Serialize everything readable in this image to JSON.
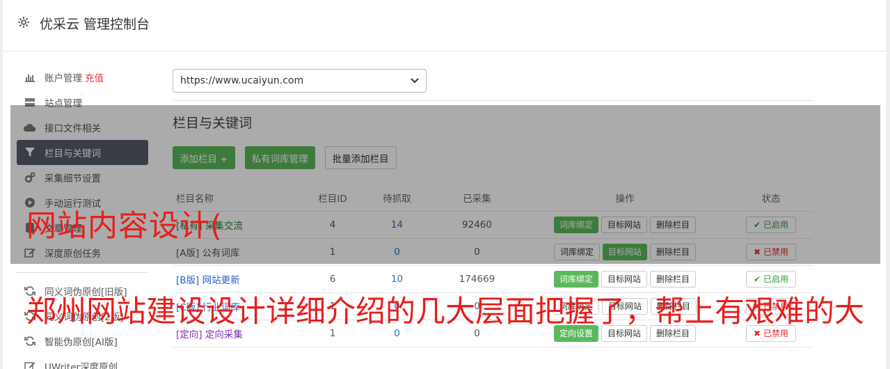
{
  "header": {
    "title": "优采云 管理控制台"
  },
  "sidebar": {
    "items": [
      {
        "label": "账户管理",
        "extra": "充值"
      },
      {
        "label": "站点管理"
      },
      {
        "label": "接口文件相关"
      },
      {
        "label": "栏目与关键词"
      },
      {
        "label": "采集细节设置"
      },
      {
        "label": "手动运行测试"
      },
      {
        "label": "文章管理"
      },
      {
        "label": "深度原创任务"
      },
      {
        "label": "同义词伪原创[旧版]"
      },
      {
        "label": "同义词伪原创[2版]"
      },
      {
        "label": "智能伪原创[AI版]"
      },
      {
        "label": "UWriter深度原创"
      }
    ]
  },
  "main": {
    "site_select": {
      "value": "https://www.ucaiyun.com"
    },
    "section_title": "栏目与关键词",
    "buttons": {
      "add": "添加栏目 +",
      "private": "私有词库管理",
      "batch": "批量添加栏目"
    },
    "table": {
      "headers": [
        "栏目名称",
        "栏目ID",
        "待抓取",
        "已采集",
        "操作",
        "状态"
      ],
      "rows": [
        {
          "name": "[私有] 采集交流",
          "id": "4",
          "pending": "14",
          "collected": "92460",
          "op1": "词库绑定",
          "op2": "目标网站",
          "op3": "删除栏目",
          "status": "已启用"
        },
        {
          "name": "[A版] 公有词库",
          "id": "1",
          "pending": "0",
          "collected": "0",
          "op1": "词库绑定",
          "op2": "目标网站",
          "op3": "删除栏目",
          "status": "已禁用"
        },
        {
          "name": "[B版] 网站更新",
          "id": "6",
          "pending": "10",
          "collected": "174669",
          "op1": "词库绑定",
          "op2": "目标网站",
          "op3": "删除栏目",
          "status": "已启用"
        },
        {
          "name": "[C版] 行业词库",
          "id": "1",
          "pending": "0",
          "collected": "0",
          "op1": "词库绑定",
          "op2": "目标网站",
          "op3": "删除栏目",
          "status": "已禁用"
        },
        {
          "name": "[定向] 定向采集",
          "id": "1",
          "pending": "0",
          "collected": "0",
          "op1": "定向设置",
          "op2": "目标网站",
          "op3": "删除栏目",
          "status": "已禁用"
        }
      ]
    }
  },
  "watermark": {
    "line1": "网站内容设计(",
    "line2": "郑州网站建设设计详细介绍的几大层面把握了，帮上有艰难的大"
  },
  "colors": {
    "accent_green": "#5cb85c",
    "active_sidebar": "#565d69",
    "watermark": "#e81d1d"
  }
}
